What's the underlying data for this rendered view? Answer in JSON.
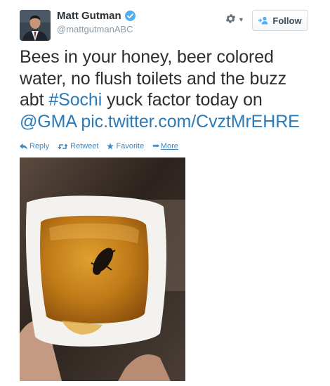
{
  "author": {
    "name": "Matt Gutman",
    "handle": "@mattgutmanABC",
    "verified": true
  },
  "header_actions": {
    "settings_icon": "gear-icon",
    "follow_label": "Follow",
    "follow_icon": "add-person-icon"
  },
  "tweet": {
    "text_before_hashtag": "Bees in your honey, beer colored water, no flush toilets and the buzz abt ",
    "hashtag": "#Sochi",
    "text_after_hashtag": " yuck factor today on ",
    "mention": "@GMA",
    "media_link": "pic.twitter.com/CvztMrEHRE"
  },
  "actions": {
    "reply_label": "Reply",
    "retweet_label": "Retweet",
    "favorite_label": "Favorite",
    "more_label": "More"
  },
  "colors": {
    "link": "#2b7bb9",
    "action_blue": "#3b88c3",
    "verified_badge": "#55acee",
    "text": "#292f33",
    "muted": "#8899a6"
  }
}
